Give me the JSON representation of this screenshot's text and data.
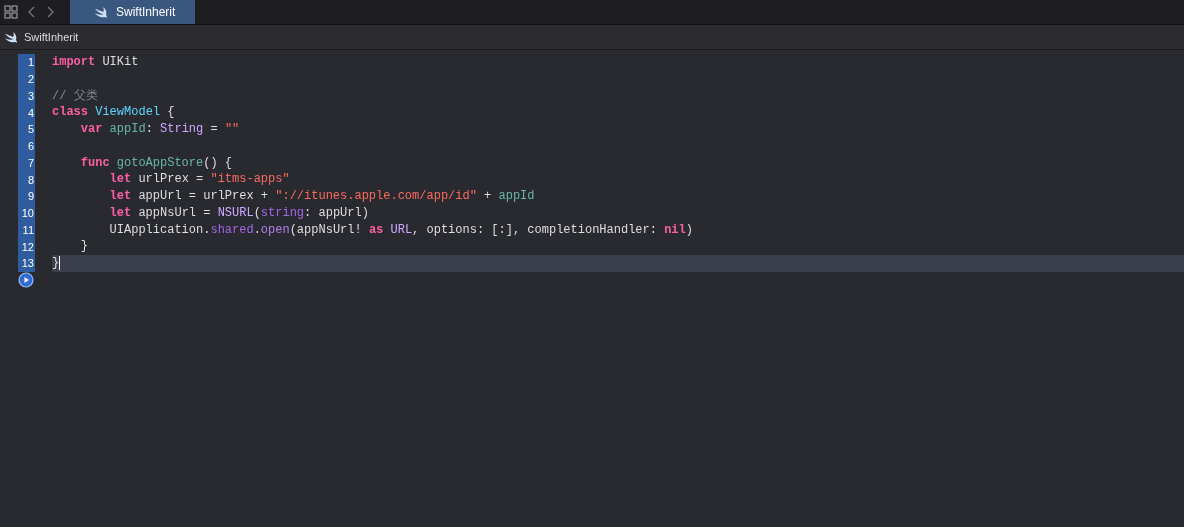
{
  "tab_bar": {
    "tabs": [
      {
        "label": "SwiftInherit",
        "selected": true
      }
    ]
  },
  "breadcrumb": {
    "label": "SwiftInherit"
  },
  "editor": {
    "lines": [
      {
        "number": "1",
        "selected": true,
        "current": false,
        "tokens": [
          {
            "kind": "keyword",
            "text": "import"
          },
          {
            "kind": "plain",
            "text": " UIKit"
          }
        ]
      },
      {
        "number": "2",
        "selected": true,
        "current": false
      },
      {
        "number": "3",
        "selected": true,
        "current": false,
        "tokens": [
          {
            "kind": "comment",
            "text": "// 父类"
          }
        ]
      },
      {
        "number": "4",
        "selected": true,
        "current": false,
        "tokens": [
          {
            "kind": "keyword",
            "text": "class"
          },
          {
            "kind": "decl",
            "text": " ViewModel"
          },
          {
            "kind": "plain",
            "text": " {"
          }
        ]
      },
      {
        "number": "5",
        "selected": true,
        "current": false,
        "tokens": [
          {
            "kind": "keyword",
            "text": "    var"
          },
          {
            "kind": "project",
            "text": " appId"
          },
          {
            "kind": "plain",
            "text": ": "
          },
          {
            "kind": "systype",
            "text": "String"
          },
          {
            "kind": "plain",
            "text": " = "
          },
          {
            "kind": "string",
            "text": "\"\""
          }
        ]
      },
      {
        "number": "6",
        "selected": true,
        "current": false
      },
      {
        "number": "7",
        "selected": true,
        "current": false,
        "tokens": [
          {
            "kind": "keyword",
            "text": "    func"
          },
          {
            "kind": "project",
            "text": " gotoAppStore"
          },
          {
            "kind": "plain",
            "text": "() {"
          }
        ]
      },
      {
        "number": "8",
        "selected": true,
        "current": false,
        "tokens": [
          {
            "kind": "keyword",
            "text": "        let"
          },
          {
            "kind": "plain",
            "text": " urlPrex = "
          },
          {
            "kind": "string",
            "text": "\"itms-apps\""
          }
        ]
      },
      {
        "number": "9",
        "selected": true,
        "current": false,
        "tokens": [
          {
            "kind": "keyword",
            "text": "        let"
          },
          {
            "kind": "plain",
            "text": " appUrl = urlPrex + "
          },
          {
            "kind": "string",
            "text": "\"://itunes.apple.com/app/id\""
          },
          {
            "kind": "plain",
            "text": " + "
          },
          {
            "kind": "project",
            "text": "appId"
          }
        ]
      },
      {
        "number": "10",
        "selected": true,
        "current": false,
        "tokens": [
          {
            "kind": "keyword",
            "text": "        let"
          },
          {
            "kind": "plain",
            "text": " appNsUrl = "
          },
          {
            "kind": "systype",
            "text": "NSURL"
          },
          {
            "kind": "plain",
            "text": "("
          },
          {
            "kind": "member",
            "text": "string"
          },
          {
            "kind": "plain",
            "text": ": appUrl)"
          }
        ]
      },
      {
        "number": "11",
        "selected": true,
        "current": false,
        "tokens": [
          {
            "kind": "plain",
            "text": "        UIApplication."
          },
          {
            "kind": "member",
            "text": "shared"
          },
          {
            "kind": "plain",
            "text": "."
          },
          {
            "kind": "method",
            "text": "open"
          },
          {
            "kind": "plain",
            "text": "(appNsUrl! "
          },
          {
            "kind": "keyword",
            "text": "as"
          },
          {
            "kind": "systype",
            "text": " URL"
          },
          {
            "kind": "plain",
            "text": ", options: [:], completionHandler: "
          },
          {
            "kind": "keyword",
            "text": "nil"
          },
          {
            "kind": "plain",
            "text": ")"
          }
        ]
      },
      {
        "number": "12",
        "selected": true,
        "current": false,
        "tokens": [
          {
            "kind": "plain",
            "text": "    }"
          }
        ]
      },
      {
        "number": "13",
        "selected": true,
        "current": true,
        "tokens": [
          {
            "kind": "plain",
            "text": "}"
          }
        ]
      }
    ]
  }
}
